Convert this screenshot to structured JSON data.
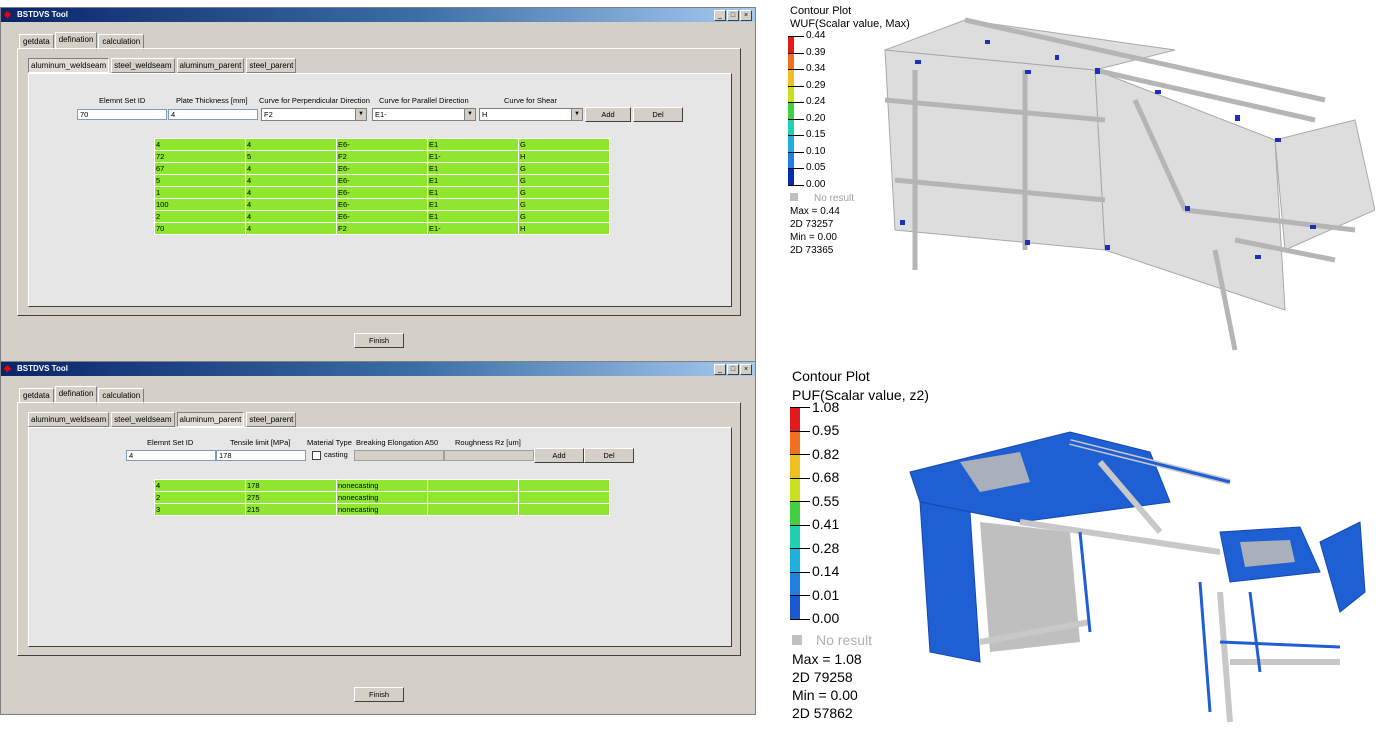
{
  "window1": {
    "title": "BSTDVS Tool",
    "window_buttons": [
      "_",
      "□",
      "×"
    ],
    "top_tabs": [
      "getdata",
      "defination",
      "calculation"
    ],
    "active_top_tab": 1,
    "sub_tabs": [
      "aluminum_weldseam",
      "steel_weldseam",
      "aluminum_parent",
      "steel_parent"
    ],
    "active_sub_tab": 0,
    "labels": {
      "elem_set": "Elemnt Set ID",
      "plate_thickness": "Plate Thickness [mm]",
      "curve_perp": "Curve for Perpendicular Direction",
      "curve_parallel": "Curve for Parallel Direction",
      "curve_shear": "Curve for Shear"
    },
    "inputs": {
      "elem_set": "70",
      "plate_thickness": "4",
      "curve_perp": "F2",
      "curve_parallel": "E1-",
      "curve_shear": "H"
    },
    "add_label": "Add",
    "del_label": "Del",
    "rows": [
      [
        "4",
        "4",
        "E6-",
        "E1",
        "G"
      ],
      [
        "72",
        "5",
        "F2",
        "E1-",
        "H"
      ],
      [
        "67",
        "4",
        "E6-",
        "E1",
        "G"
      ],
      [
        "5",
        "4",
        "E6-",
        "E1",
        "G"
      ],
      [
        "1",
        "4",
        "E6-",
        "E1",
        "G"
      ],
      [
        "100",
        "4",
        "E6-",
        "E1",
        "G"
      ],
      [
        "2",
        "4",
        "E6-",
        "E1",
        "G"
      ],
      [
        "70",
        "4",
        "F2",
        "E1-",
        "H"
      ]
    ],
    "finish_label": "Finish"
  },
  "window2": {
    "title": "BSTDVS Tool",
    "window_buttons": [
      "_",
      "□",
      "×"
    ],
    "top_tabs": [
      "getdata",
      "defination",
      "calculation"
    ],
    "active_top_tab": 1,
    "sub_tabs": [
      "aluminum_weldseam",
      "steel_weldseam",
      "aluminum_parent",
      "steel_parent"
    ],
    "active_sub_tab": 2,
    "labels": {
      "elem_set": "Elemnt Set ID",
      "tensile": "Tensile limit [MPa]",
      "material_type": "Material Type",
      "elongation": "Breaking Elongation A50",
      "roughness": "Roughness Rz [um]",
      "casting": "casting"
    },
    "inputs": {
      "elem_set": "4",
      "tensile": "178",
      "elongation": "",
      "roughness": ""
    },
    "add_label": "Add",
    "del_label": "Del",
    "rows": [
      [
        "4",
        "178",
        "nonecasting",
        "",
        ""
      ],
      [
        "2",
        "275",
        "nonecasting",
        "",
        ""
      ],
      [
        "3",
        "215",
        "nonecasting",
        "",
        ""
      ]
    ],
    "finish_label": "Finish"
  },
  "contour1": {
    "title": "Contour Plot",
    "subtitle": "WUF(Scalar value, Max)",
    "levels": [
      "0.44",
      "0.39",
      "0.34",
      "0.29",
      "0.24",
      "0.20",
      "0.15",
      "0.10",
      "0.05",
      "0.00"
    ],
    "colors": [
      "#e41a1a",
      "#f07020",
      "#f0c020",
      "#c8e020",
      "#40d040",
      "#20d0b0",
      "#20b0e0",
      "#2080e0",
      "#0a2ab0"
    ],
    "no_result": "No result",
    "max_line": "Max = 0.44",
    "max_elem": "2D 73257",
    "min_line": "Min = 0.00",
    "min_elem": "2D 73365"
  },
  "contour2": {
    "title": "Contour Plot",
    "subtitle": "PUF(Scalar value, z2)",
    "levels": [
      "1.08",
      "0.95",
      "0.82",
      "0.68",
      "0.55",
      "0.41",
      "0.28",
      "0.14",
      "0.01",
      "0.00"
    ],
    "colors": [
      "#e41a1a",
      "#f07020",
      "#f0c020",
      "#c8e020",
      "#40d040",
      "#20d0b0",
      "#20b0e0",
      "#2080e0",
      "#1a5ad0"
    ],
    "no_result": "No result",
    "max_line": "Max = 1.08",
    "max_elem": "2D 79258",
    "min_line": "Min = 0.00",
    "min_elem": "2D 57862"
  }
}
